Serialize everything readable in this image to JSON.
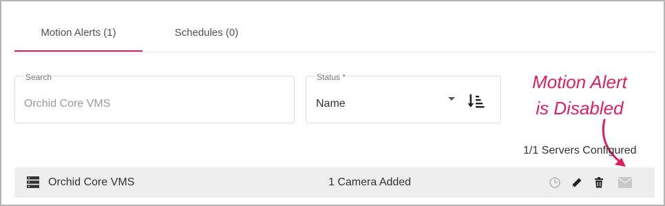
{
  "colors": {
    "accent": "#e0245e",
    "annotation": "#dd1f5c",
    "icon_dark": "#222222",
    "icon_disabled": "#c8c8c8"
  },
  "tabs": [
    {
      "label": "Motion Alerts (1)",
      "active": true
    },
    {
      "label": "Schedules (0)",
      "active": false
    }
  ],
  "search": {
    "label": "Search",
    "placeholder": "Orchid Core VMS",
    "value": ""
  },
  "status": {
    "label": "Status *",
    "value": "Name"
  },
  "annotation": {
    "line1": "Motion Alert",
    "line2": "is Disabled"
  },
  "servers_configured": "1/1 Servers Configured",
  "server_row": {
    "name": "Orchid Core VMS",
    "cameras": "1 Camera Added",
    "alert_enabled": false,
    "icons": [
      "server-icon",
      "clock-icon",
      "pencil-icon",
      "trash-icon",
      "mail-icon"
    ]
  }
}
